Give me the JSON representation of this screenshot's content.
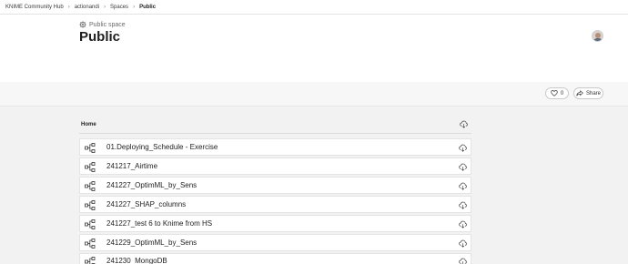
{
  "breadcrumb": {
    "items": [
      "KNIME Community Hub",
      "actionandi",
      "Spaces"
    ],
    "current": "Public"
  },
  "header": {
    "kicker": "Public space",
    "title": "Public"
  },
  "actions": {
    "like_count": "0",
    "share_label": "Share"
  },
  "explorer": {
    "folder": "Home",
    "items": [
      {
        "name": "01.Deploying_Schedule - Exercise"
      },
      {
        "name": "241217_Airtime"
      },
      {
        "name": "241227_OptimML_by_Sens"
      },
      {
        "name": "241227_SHAP_columns"
      },
      {
        "name": "241227_test 6 to Knime from HS"
      },
      {
        "name": "241229_OptimML_by_Sens"
      },
      {
        "name": "241230_MongoDB"
      }
    ]
  },
  "icons": {
    "kicker": "gear-space-icon",
    "like": "heart-icon",
    "share": "share-icon",
    "download": "cloud-download-icon",
    "workflow": "workflow-icon"
  }
}
